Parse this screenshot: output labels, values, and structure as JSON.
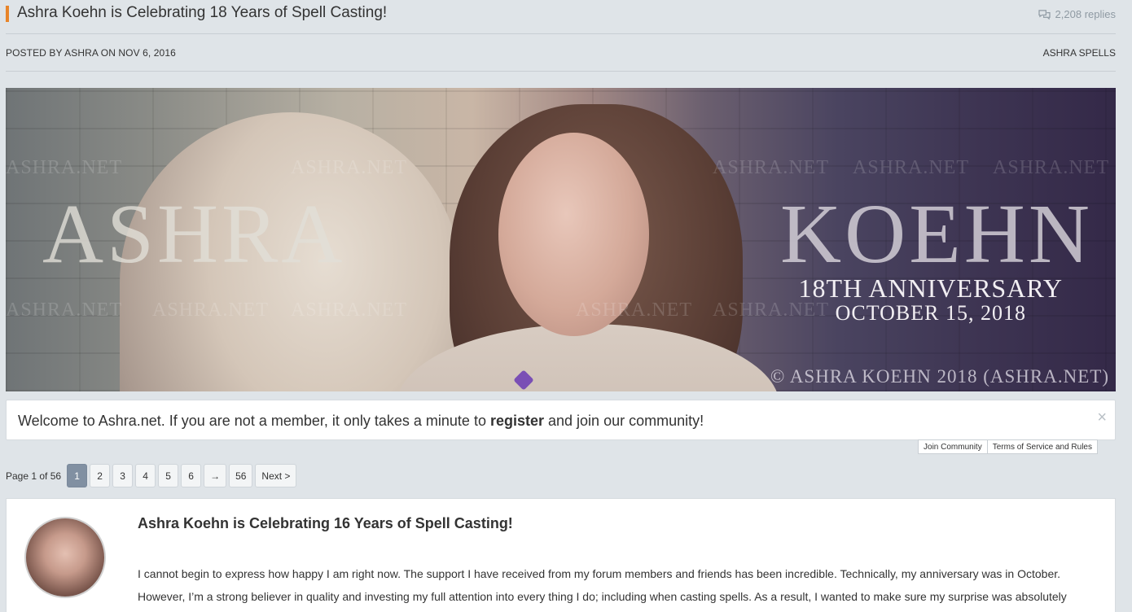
{
  "header": {
    "title": "Ashra Koehn is Celebrating 18 Years of Spell Casting!",
    "replies": "2,208 replies",
    "icon": "speech-bubbles-icon"
  },
  "meta": {
    "posted": "POSTED BY ASHRA ON NOV 6, 2016",
    "category": "ASHRA SPELLS"
  },
  "banner": {
    "name_left": "ASHRA",
    "name_right": "KOEHN",
    "anniversary": "18TH ANNIVERSARY",
    "date": "OCTOBER 15, 2018",
    "copyright": "© ASHRA KOEHN 2018 (ASHRA.NET)",
    "watermark": "ASHRA.NET"
  },
  "welcome": {
    "text_before": "Welcome to Ashra.net. If you are not a member, it only takes a minute to ",
    "register": "register",
    "text_after": " and join our community!",
    "close": "×"
  },
  "links": {
    "join": "Join Community",
    "terms": "Terms of Service and Rules"
  },
  "pager": {
    "label": "Page 1 of 56",
    "pages": [
      "1",
      "2",
      "3",
      "4",
      "5",
      "6",
      "→",
      "56",
      "Next >"
    ],
    "current": "1"
  },
  "post": {
    "title": "Ashra Koehn is Celebrating 16 Years of Spell Casting!",
    "line1": "I cannot begin to express how happy I am right now. The support I have received from my forum members and friends has been incredible. Technically, my anniversary was in October.",
    "line2": "However, I’m a strong believer in quality and investing my full attention into every thing I do; including when casting spells. As a result, I wanted to make sure my surprise was absolutely"
  }
}
